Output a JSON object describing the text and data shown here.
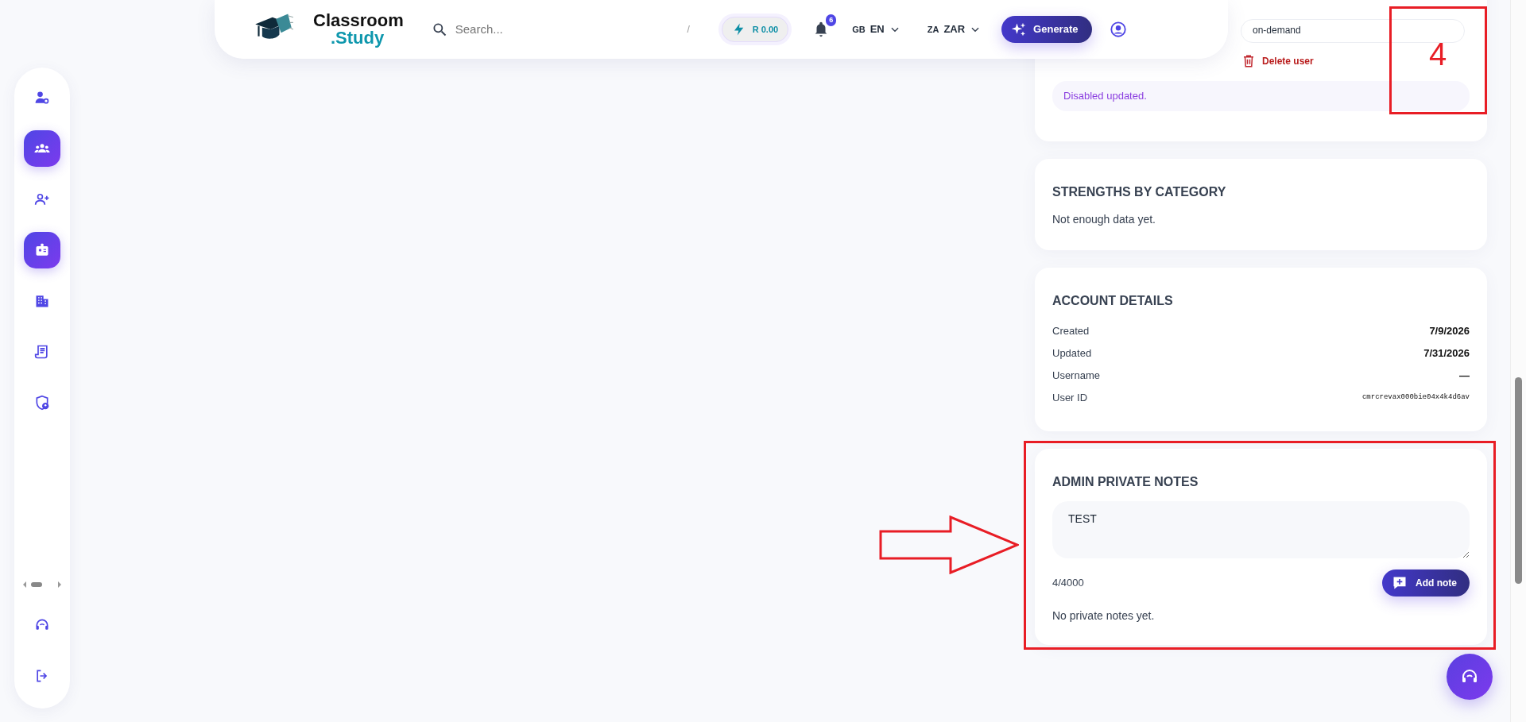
{
  "header": {
    "logo_top": "Classroom",
    "logo_bottom": ".Study",
    "search": {
      "placeholder": "Search...",
      "shortcut": "/"
    },
    "credit": "R 0.00",
    "notifications": "6",
    "language": {
      "code": "GB",
      "label": "EN"
    },
    "currency": {
      "code": "ZA",
      "label": "ZAR"
    },
    "generate": "Generate"
  },
  "sidebar": {
    "items": [
      {
        "selected": false
      },
      {
        "selected": true
      },
      {
        "selected": false
      },
      {
        "selected": true
      },
      {
        "selected": false
      },
      {
        "selected": false
      },
      {
        "selected": false
      }
    ]
  },
  "user_card": {
    "field_value": "on-demand",
    "delete": "Delete user",
    "alert": "Disabled updated."
  },
  "strengths": {
    "title": "STRENGTHS BY CATEGORY",
    "empty": "Not enough data yet."
  },
  "account": {
    "title": "ACCOUNT DETAILS",
    "rows": [
      {
        "label": "Created",
        "value": "7/9/2026",
        "kind": "bold"
      },
      {
        "label": "Updated",
        "value": "7/31/2026",
        "kind": "bold"
      },
      {
        "label": "Username",
        "value": "—",
        "kind": "bold"
      },
      {
        "label": "User ID",
        "value": "cmrcrevax000bie04x4k4d6av",
        "kind": "mono"
      }
    ]
  },
  "notes": {
    "title": "ADMIN PRIVATE NOTES",
    "value": "TEST",
    "counter": "4/4000",
    "add": "Add note",
    "empty": "No private notes yet."
  },
  "annotation": {
    "number": "4"
  }
}
